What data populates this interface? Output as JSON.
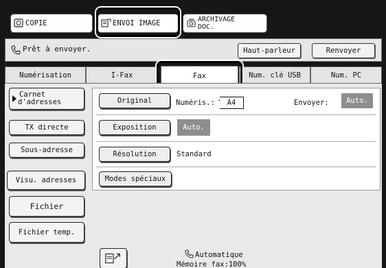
{
  "modes": [
    {
      "label": "COPIE",
      "icon": "copy-icon"
    },
    {
      "label": "ENVOI IMAGE",
      "icon": "image-send-icon"
    },
    {
      "label": "ARCHIVAGE DOC.",
      "icon": "archive-icon"
    }
  ],
  "status": {
    "text": "Prêt à envoyer.",
    "icon": "phone-icon",
    "speaker_label": "Haut-parleur",
    "resend_label": "Renvoyer"
  },
  "tabs": [
    {
      "label": "Numérisation"
    },
    {
      "label": "I-Fax"
    },
    {
      "label": "Fax",
      "active": true
    },
    {
      "label": "Num. clé USB"
    },
    {
      "label": "Num. PC"
    }
  ],
  "sidebar": [
    {
      "label_line1": "Carnet",
      "label_line2": "d'adresses"
    },
    {
      "label": "TX directe"
    },
    {
      "label": "Sous-adresse"
    },
    {
      "label": "Visu. adresses"
    },
    {
      "label": "Fichier"
    },
    {
      "label": "Fichier temp."
    }
  ],
  "settings": {
    "original_label": "Original",
    "scan_label": "Numéris.:",
    "scan_value": "A4",
    "send_label": "Envoyer:",
    "send_value": "Auto.",
    "exposure_label": "Exposition",
    "exposure_value": "Auto.",
    "resolution_label": "Résolution",
    "resolution_value": "Standard",
    "special_label": "Modes spéciaux"
  },
  "footer": {
    "mode_text": "Automatique",
    "memory_text": "Mémoire fax:100%",
    "icon": "fax-receive-icon"
  },
  "colors": {
    "background": "#161616",
    "panel": "#e9e9e9",
    "highlight_box": "#000000",
    "auto_badge": "#8e8e8e"
  }
}
